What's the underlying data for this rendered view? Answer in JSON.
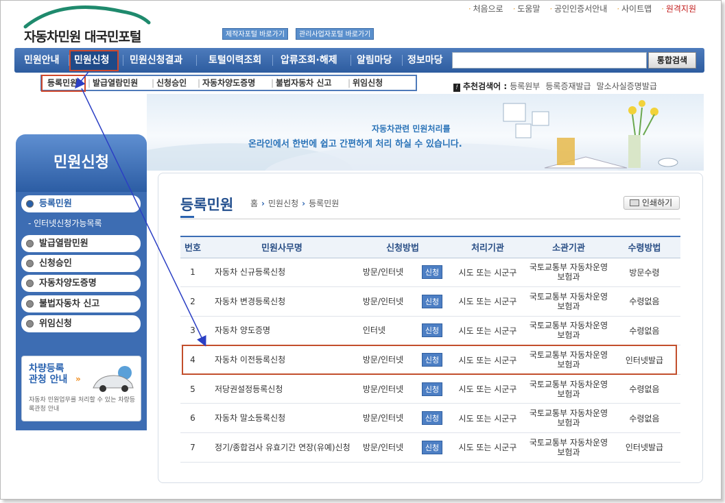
{
  "header": {
    "logo_text": "자동차민원 대국민포털",
    "portal_buttons": [
      "제작자포털 바로가기",
      "관리사업자포털 바로가기"
    ],
    "util_links": [
      "처음으로",
      "도움말",
      "공인인증서안내",
      "사이트맵",
      "원격지원"
    ]
  },
  "gnb": {
    "items": [
      "민원안내",
      "민원신청",
      "민원신청결과",
      "토털이력조회",
      "압류조회·해제",
      "알림마당",
      "정보마당"
    ],
    "active": "민원신청",
    "search_placeholder": "",
    "search_button": "통합검색"
  },
  "subnav": {
    "items": [
      "등록민원",
      "발급열람민원",
      "신청승인",
      "자동차양도증명",
      "불법자동차 신고",
      "위임신청"
    ]
  },
  "recommend": {
    "label": "추천검색어 :",
    "keywords": [
      "등록원부",
      "등록증재발급",
      "말소사실증명발급"
    ]
  },
  "banner": {
    "line1": "자동차관련 민원처리를",
    "line2": "온라인에서 한번에 쉽고 간편하게 처리 하실 수 있습니다."
  },
  "lnb": {
    "title": "민원신청",
    "items": [
      "등록민원",
      "발급열람민원",
      "신청승인",
      "자동차양도증명",
      "불법자동차 신고",
      "위임신청"
    ],
    "sub_item": "- 인터넷신청가능목록",
    "ad_title_1": "차량등록",
    "ad_title_2": "관청 안내",
    "ad_desc": "자동차 민원업무를 처리할 수 있는 차량등록관청 안내"
  },
  "content": {
    "title": "등록민원",
    "breadcrumb": [
      "홈",
      "민원신청",
      "등록민원"
    ],
    "print_label": "인쇄하기",
    "columns": [
      "번호",
      "민원사무명",
      "신청방법",
      "처리기관",
      "소관기관",
      "수령방법"
    ],
    "apply_label": "신청",
    "rows": [
      {
        "no": "1",
        "name": "자동차 신규등록신청",
        "method": "방문/인터넷",
        "agency": "시도 또는 시군구",
        "org": "국토교통부 자동차운영보험과",
        "receive": "방문수령"
      },
      {
        "no": "2",
        "name": "자동차 변경등록신청",
        "method": "방문/인터넷",
        "agency": "시도 또는 시군구",
        "org": "국토교통부 자동차운영보험과",
        "receive": "수령없음"
      },
      {
        "no": "3",
        "name": "자동차 양도증명",
        "method": "인터넷",
        "agency": "시도 또는 시군구",
        "org": "국토교통부 자동차운영보험과",
        "receive": "수령없음"
      },
      {
        "no": "4",
        "name": "자동차 이전등록신청",
        "method": "방문/인터넷",
        "agency": "시도 또는 시군구",
        "org": "국토교통부 자동차운영보험과",
        "receive": "인터넷발급"
      },
      {
        "no": "5",
        "name": "저당권설정등록신청",
        "method": "방문/인터넷",
        "agency": "시도 또는 시군구",
        "org": "국토교통부 자동차운영보험과",
        "receive": "수령없음"
      },
      {
        "no": "6",
        "name": "자동차 말소등록신청",
        "method": "방문/인터넷",
        "agency": "시도 또는 시군구",
        "org": "국토교통부 자동차운영보험과",
        "receive": "수령없음"
      },
      {
        "no": "7",
        "name": "정기/종합검사 유효기간 연장(유예)신청",
        "method": "방문/인터넷",
        "agency": "시도 또는 시군구",
        "org": "국토교통부 자동차운영보험과",
        "receive": "인터넷발급"
      }
    ]
  },
  "colors": {
    "accent": "#2a63b0",
    "highlight": "#c24e2b",
    "gnb": "#3a68aa"
  }
}
